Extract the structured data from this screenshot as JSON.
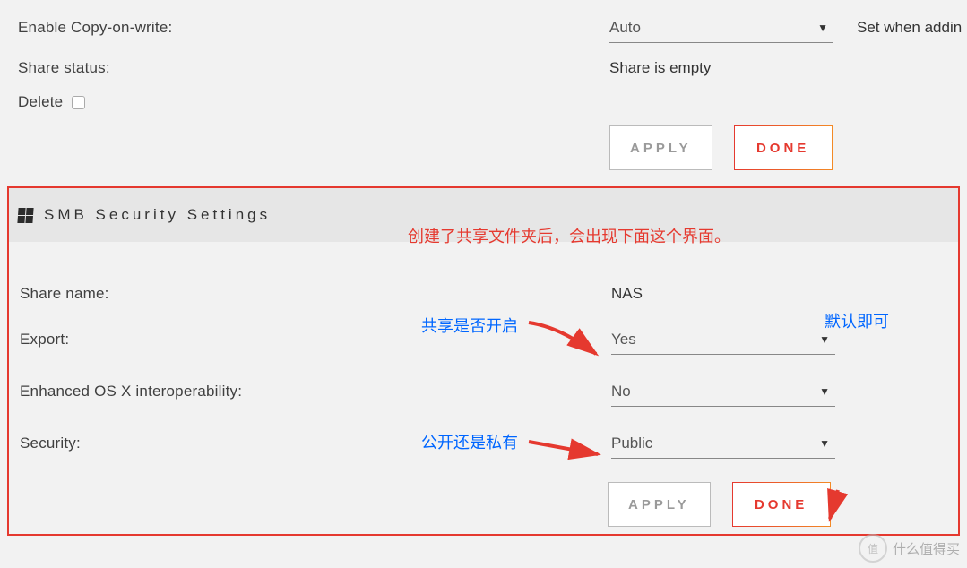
{
  "top": {
    "cow_label": "Enable Copy-on-write:",
    "cow_value": "Auto",
    "cow_hint": "Set when addin",
    "status_label": "Share status:",
    "status_value": "Share is empty",
    "delete_label": "Delete",
    "apply": "APPLY",
    "done": "DONE"
  },
  "panel": {
    "title": "SMB Security Settings",
    "share_name_label": "Share name:",
    "share_name_value": "NAS",
    "export_label": "Export:",
    "export_value": "Yes",
    "osx_label": "Enhanced OS X interoperability:",
    "osx_value": "No",
    "security_label": "Security:",
    "security_value": "Public",
    "apply": "APPLY",
    "done": "DONE"
  },
  "annotations": {
    "header_note": "创建了共享文件夹后，会出现下面这个界面。",
    "export_note": "共享是否开启",
    "default_note": "默认即可",
    "security_note": "公开还是私有"
  },
  "watermark": "什么值得买"
}
